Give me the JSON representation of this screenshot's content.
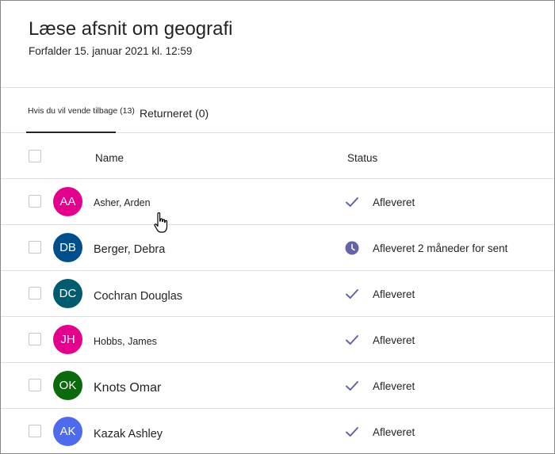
{
  "assignment": {
    "title": "Læse afsnit om geografi",
    "due": "Forfalder 15. januar 2021 kl. 12:59"
  },
  "tabs": {
    "to_return": "Hvis du vil vende tilbage (13)",
    "returned": "Returneret (0)"
  },
  "columns": {
    "name": "Name",
    "status": "Status"
  },
  "students": [
    {
      "initials": "AA",
      "name": "Asher, Arden",
      "status": "Afleveret",
      "status_icon": "check-icon",
      "avatar_color": "#e3008c"
    },
    {
      "initials": "DB",
      "name": "Berger, Debra",
      "status": "Afleveret 2 måneder for sent",
      "status_icon": "clock-icon",
      "avatar_color": "#004e8c"
    },
    {
      "initials": "DC",
      "name": "Cochran Douglas",
      "status": "Afleveret",
      "status_icon": "check-icon",
      "avatar_color": "#005b70"
    },
    {
      "initials": "JH",
      "name": "Hobbs, James",
      "status": "Afleveret",
      "status_icon": "check-icon",
      "avatar_color": "#e3008c"
    },
    {
      "initials": "OK",
      "name": "Knots Omar",
      "status": "Afleveret",
      "status_icon": "check-icon",
      "avatar_color": "#0b6a0b"
    },
    {
      "initials": "AK",
      "name": "Kazak Ashley",
      "status": "Afleveret",
      "status_icon": "check-icon",
      "avatar_color": "#4f6bed"
    }
  ],
  "colors": {
    "accent": "#6264a7",
    "divider": "#e1dfdd",
    "text": "#252423"
  }
}
